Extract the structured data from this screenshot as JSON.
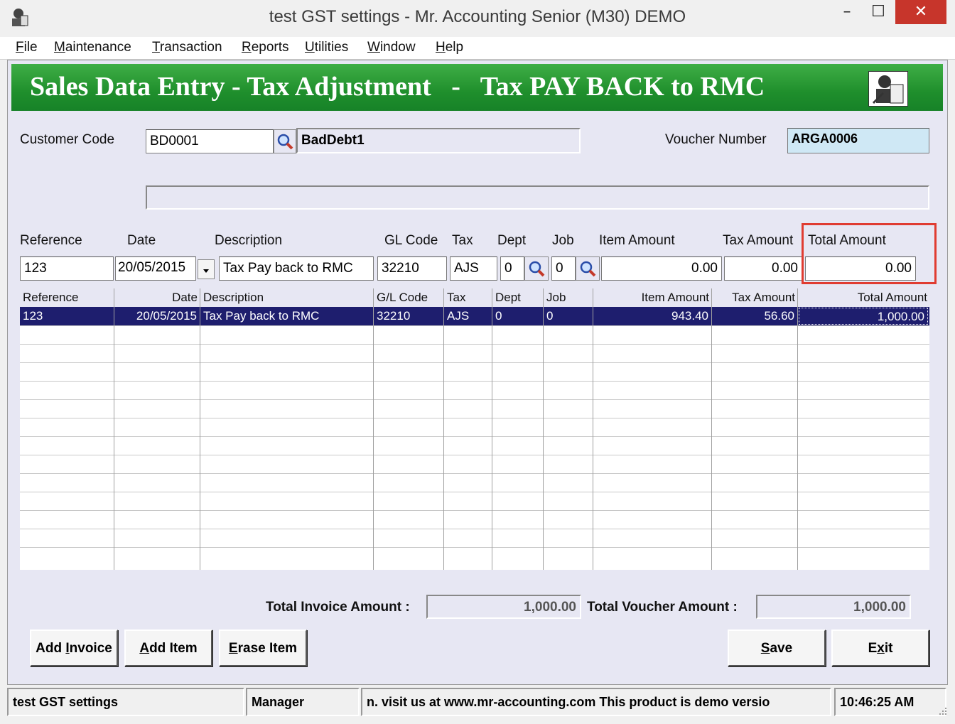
{
  "window": {
    "title": "test GST settings - Mr. Accounting Senior (M30) DEMO",
    "minimize": "–",
    "maximize": "☐",
    "close": "✕"
  },
  "menu": {
    "file": {
      "u": "F",
      "rest": "ile"
    },
    "maintenance": {
      "u": "M",
      "rest": "aintenance"
    },
    "transaction": {
      "u": "T",
      "rest": "ransaction"
    },
    "reports": {
      "u": "R",
      "rest": "eports"
    },
    "utilities": {
      "u": "U",
      "rest": "tilities"
    },
    "window": {
      "u": "W",
      "rest": "indow"
    },
    "help": {
      "u": "H",
      "rest": "elp"
    }
  },
  "banner": {
    "title": "Sales Data Entry - Tax Adjustment   -   Tax PAY BACK to RMC"
  },
  "header": {
    "customer_code_label": "Customer Code",
    "customer_code": "BD0001",
    "customer_name": "BadDebt1",
    "voucher_label": "Voucher Number",
    "voucher": "ARGA0006",
    "address": ""
  },
  "entry": {
    "labels": {
      "reference": "Reference",
      "date": "Date",
      "description": "Description",
      "gl_code": "GL Code",
      "tax": "Tax",
      "dept": "Dept",
      "job": "Job",
      "item_amount": "Item Amount",
      "tax_amount": "Tax Amount",
      "total_amount": "Total Amount"
    },
    "values": {
      "reference": "123",
      "date": "20/05/2015",
      "description": "Tax Pay back to RMC",
      "gl_code": "32210",
      "tax": "AJS",
      "dept": "0",
      "job": "0",
      "item_amount": "0.00",
      "tax_amount": "0.00",
      "total_amount": "0.00"
    },
    "highlight_color": "#e03c31"
  },
  "grid": {
    "columns": [
      "Reference",
      "Date",
      "Description",
      "G/L Code",
      "Tax",
      "Dept",
      "Job",
      "Item Amount",
      "Tax Amount",
      "Total Amount"
    ],
    "rows": [
      [
        "123",
        "20/05/2015",
        "Tax Pay back to RMC",
        "32210",
        "AJS",
        "0",
        "0",
        "943.40",
        "56.60",
        "1,000.00"
      ]
    ],
    "selected_color": "#1e1e6e"
  },
  "totals": {
    "invoice_label": "Total Invoice Amount :",
    "invoice": "1,000.00",
    "voucher_label": "Total  Voucher Amount :",
    "voucher": "1,000.00"
  },
  "buttons": {
    "add_invoice": {
      "pre": "Add ",
      "u": "I",
      "rest": "nvoice"
    },
    "add_item": {
      "pre": "",
      "u": "A",
      "rest": "dd Item"
    },
    "erase_item": {
      "pre": "",
      "u": "E",
      "rest": "rase Item"
    },
    "save": {
      "pre": "",
      "u": "S",
      "rest": "ave"
    },
    "exit": {
      "pre": "E",
      "u": "x",
      "rest": "it"
    }
  },
  "status": {
    "company": "test GST settings",
    "user": "Manager",
    "message": "n.  visit us at www.mr-accounting.com This product is demo versio",
    "time": "10:46:25 AM"
  }
}
